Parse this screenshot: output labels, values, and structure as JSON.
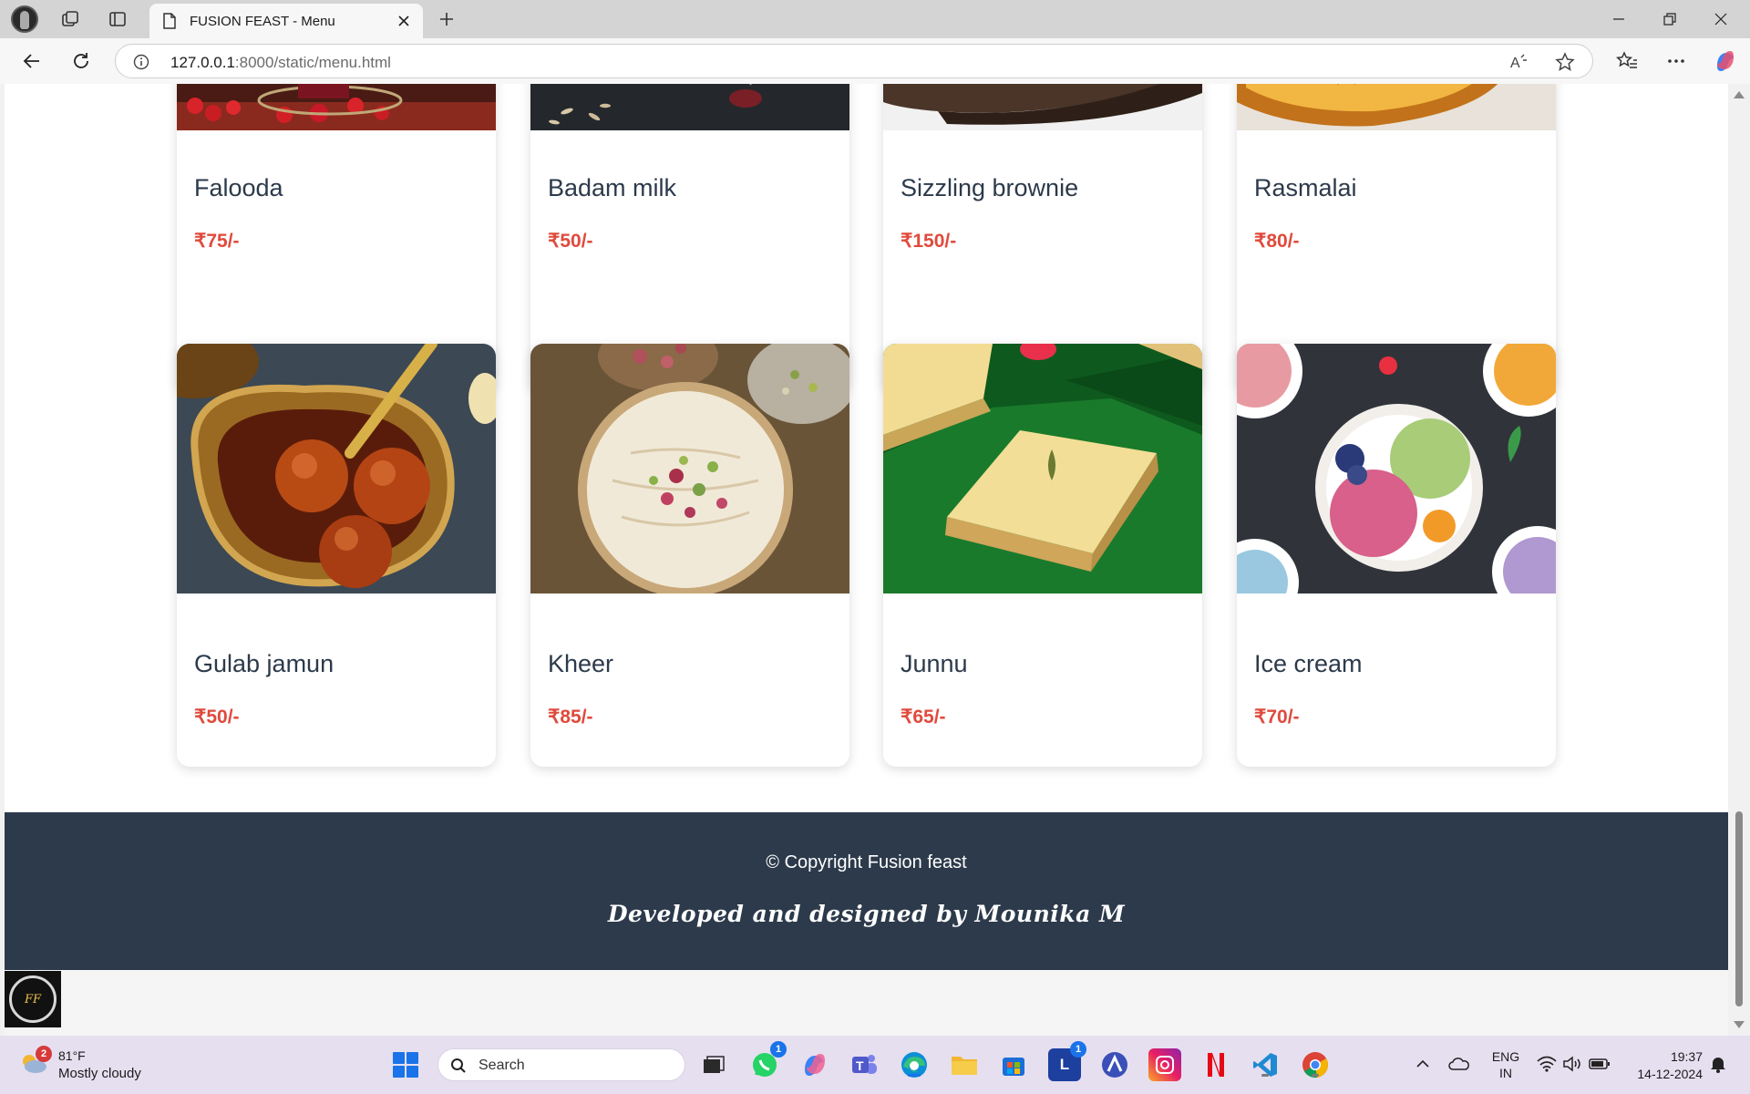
{
  "browser": {
    "tab_title": "FUSION FEAST - Menu",
    "url_host": "127.0.0.1",
    "url_path": ":8000/static/menu.html"
  },
  "menu": {
    "row1": [
      {
        "name": "Falooda",
        "price": "₹75/-"
      },
      {
        "name": "Badam milk",
        "price": "₹50/-"
      },
      {
        "name": "Sizzling brownie",
        "price": "₹150/-"
      },
      {
        "name": "Rasmalai",
        "price": "₹80/-"
      }
    ],
    "row2": [
      {
        "name": "Gulab jamun",
        "price": "₹50/-"
      },
      {
        "name": "Kheer",
        "price": "₹85/-"
      },
      {
        "name": "Junnu",
        "price": "₹65/-"
      },
      {
        "name": "Ice cream",
        "price": "₹70/-"
      }
    ]
  },
  "footer": {
    "copyright": "© Copyright Fusion feast",
    "credit": "Developed and designed by Mounika M"
  },
  "taskbar": {
    "weather_badge": "2",
    "temperature": "81°F",
    "condition": "Mostly cloudy",
    "search_label": "Search",
    "whatsapp_badge": "1",
    "l_app_badge": "1",
    "language": "ENG",
    "region": "IN",
    "time": "19:37",
    "date": "14-12-2024"
  },
  "colors": {
    "footer_bg": "#2c3a4b",
    "price": "#e04a3c",
    "item_name": "#2c3a4b"
  }
}
